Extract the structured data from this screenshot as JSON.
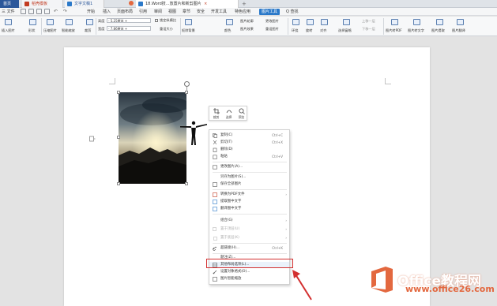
{
  "tabs": [
    {
      "label": "首页"
    },
    {
      "label": "稻壳模板"
    },
    {
      "label": "文字文稿1"
    },
    {
      "label": "18.Word技...放置片和新剪图片"
    }
  ],
  "menu": [
    "三 文件",
    "开始",
    "插入",
    "页面布局",
    "引用",
    "审阅",
    "视图",
    "章节",
    "安全",
    "开发工具",
    "特色应用",
    "图片工具",
    "Q 查找"
  ],
  "ribbon": {
    "insert_picture": "插入图片",
    "shape": "形状",
    "compress": "压缩图片",
    "smart_resize": "智能缩放",
    "crop": "裁剪",
    "height_label": "高度",
    "height_value": "- 5.25厘米 +",
    "width_label": "宽度",
    "width_value": "- 7.86厘米 +",
    "lock_ratio": "锁定纵横比",
    "reset_size": "重设大小",
    "remove_bg": "抠除背景",
    "color": "颜色",
    "picture_border": "图片轮廓",
    "picture_effect": "图片效果",
    "change_picture": "更改图片",
    "reset_picture": "重设图片",
    "wrap": "环绕",
    "rotate": "旋转",
    "align": "对齐",
    "selection_pane": "选择窗格",
    "bring_forward": "上移一层",
    "send_backward": "下移一层",
    "to_pdf": "图片转PDF",
    "to_text": "图片转文字",
    "extract": "图片提取",
    "translate": "图片翻译"
  },
  "mini_toolbar": [
    "裁剪",
    "选择",
    "预览"
  ],
  "context_menu": [
    {
      "label": "复制(C)",
      "shortcut": "Ctrl+C",
      "icon": "copy-icon"
    },
    {
      "label": "剪切(T)",
      "shortcut": "Ctrl+X",
      "icon": "cut-icon"
    },
    {
      "label": "删除(D)",
      "shortcut": "",
      "icon": "delete-icon"
    },
    {
      "label": "粘贴",
      "shortcut": "Ctrl+V",
      "icon": "paste-icon"
    },
    {
      "label": "更改图片(A)...",
      "shortcut": "",
      "icon": "change-image-icon"
    },
    {
      "label": "另存为图片(S)...",
      "shortcut": "",
      "icon": "save-image-icon"
    },
    {
      "label": "保存全部图片",
      "shortcut": "",
      "icon": "save-all-icon"
    },
    {
      "label": "转换为PDF文件",
      "shortcut": "",
      "icon": "pdf-icon",
      "arrow": true
    },
    {
      "label": "提取图中文字",
      "shortcut": "",
      "icon": "extract-text-icon"
    },
    {
      "label": "翻译图中文字",
      "shortcut": "",
      "icon": "translate-icon"
    },
    {
      "label": "组合(G)",
      "shortcut": "",
      "icon": "group-icon",
      "arrow": true
    },
    {
      "label": "置于顶层(U)",
      "shortcut": "",
      "icon": "bring-front-icon",
      "arrow": true,
      "disabled": true
    },
    {
      "label": "置于底层(K)",
      "shortcut": "",
      "icon": "send-back-icon",
      "arrow": true,
      "disabled": true
    },
    {
      "label": "超链接(H)...",
      "shortcut": "Ctrl+K",
      "icon": "link-icon"
    },
    {
      "label": "题注(Z)...",
      "shortcut": "",
      "icon": "caption-icon"
    },
    {
      "label": "其他布局选项(L)...",
      "shortcut": "",
      "icon": "layout-icon",
      "highlighted": true
    },
    {
      "label": "设置对象格式(O)...",
      "shortcut": "",
      "icon": "format-icon"
    },
    {
      "label": "图片智能缩放",
      "shortcut": "",
      "icon": "smart-resize-icon"
    }
  ],
  "watermark": {
    "title": "Office教程网",
    "url": "www.office26.com"
  },
  "colors": {
    "accent": "#2b79c9",
    "highlight_border": "#d32f2f",
    "watermark_orange": "#e3683f"
  }
}
